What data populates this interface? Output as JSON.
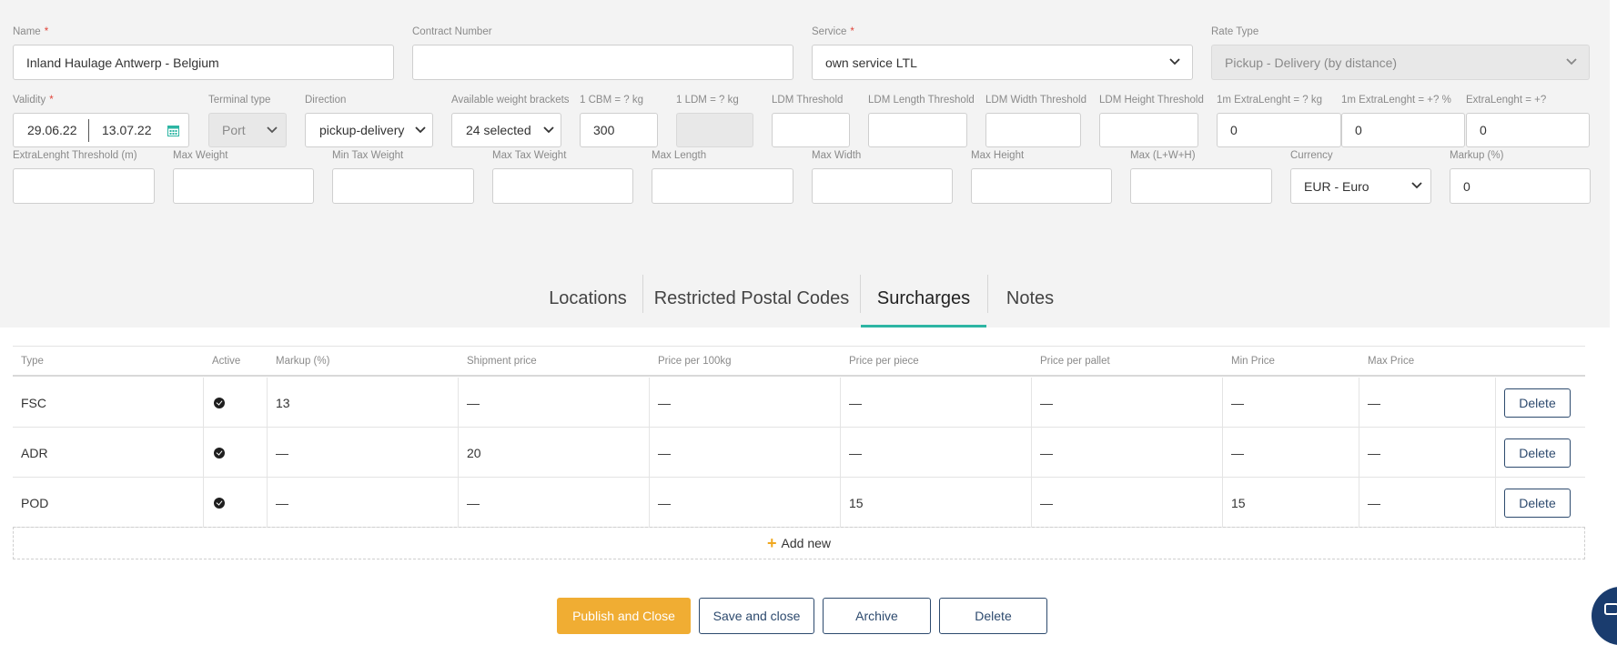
{
  "form": {
    "name": {
      "label": "Name",
      "required": "*",
      "value": "Inland Haulage Antwerp - Belgium"
    },
    "contract_number": {
      "label": "Contract Number",
      "value": ""
    },
    "service": {
      "label": "Service",
      "required": "*",
      "value": "own service LTL"
    },
    "rate_type": {
      "label": "Rate Type",
      "value": "Pickup - Delivery (by distance)"
    },
    "validity": {
      "label": "Validity",
      "required": "*",
      "from": "29.06.22",
      "to": "13.07.22"
    },
    "terminal_type": {
      "label": "Terminal type",
      "value": "Port"
    },
    "direction": {
      "label": "Direction",
      "value": "pickup-delivery"
    },
    "weight_brackets": {
      "label": "Available weight brackets",
      "value": "24 selected"
    },
    "cbm": {
      "label": "1 CBM = ? kg",
      "value": "300"
    },
    "ldm": {
      "label": "1 LDM = ? kg",
      "value": ""
    },
    "ldm_threshold": {
      "label": "LDM Threshold",
      "value": ""
    },
    "ldm_length_threshold": {
      "label": "LDM Length Threshold",
      "value": ""
    },
    "ldm_width_threshold": {
      "label": "LDM Width Threshold",
      "value": ""
    },
    "ldm_height_threshold": {
      "label": "LDM Height Threshold",
      "value": ""
    },
    "extra_length_kg": {
      "label": "1m ExtraLenght = ? kg",
      "value": "0"
    },
    "extra_length_pct": {
      "label": "1m ExtraLenght = +? %",
      "value": "0"
    },
    "extra_length_plus": {
      "label": "ExtraLenght = +?",
      "value": "0"
    },
    "extra_length_threshold": {
      "label": "ExtraLenght Threshold (m)",
      "value": ""
    },
    "max_weight": {
      "label": "Max Weight",
      "value": ""
    },
    "min_tax_weight": {
      "label": "Min Tax Weight",
      "value": ""
    },
    "max_tax_weight": {
      "label": "Max Tax Weight",
      "value": ""
    },
    "max_length": {
      "label": "Max Length",
      "value": ""
    },
    "max_width": {
      "label": "Max Width",
      "value": ""
    },
    "max_height": {
      "label": "Max Height",
      "value": ""
    },
    "max_lwh": {
      "label": "Max (L+W+H)",
      "value": ""
    },
    "currency": {
      "label": "Currency",
      "value": "EUR - Euro"
    },
    "markup": {
      "label": "Markup (%)",
      "value": "0"
    }
  },
  "tabs": [
    "Locations",
    "Restricted Postal Codes",
    "Surcharges",
    "Notes"
  ],
  "active_tab": "Surcharges",
  "table": {
    "headers": [
      "Type",
      "Active",
      "Markup (%)",
      "Shipment price",
      "Price per 100kg",
      "Price per piece",
      "Price per pallet",
      "Min Price",
      "Max Price"
    ],
    "rows": [
      [
        "FSC",
        "",
        "13",
        "—",
        "—",
        "—",
        "—",
        "—",
        "—"
      ],
      [
        "ADR",
        "",
        "—",
        "20",
        "—",
        "—",
        "—",
        "—",
        "—"
      ],
      [
        "POD",
        "",
        "—",
        "—",
        "—",
        "15",
        "—",
        "15",
        "—"
      ]
    ],
    "delete_label": "Delete",
    "add_new_label": "Add new"
  },
  "actions": {
    "publish": "Publish and Close",
    "save": "Save and close",
    "archive": "Archive",
    "delete": "Delete"
  },
  "colors": {
    "accent": "#2db5a3",
    "primary": "#f0ad33",
    "navy": "#2d4a6e"
  }
}
